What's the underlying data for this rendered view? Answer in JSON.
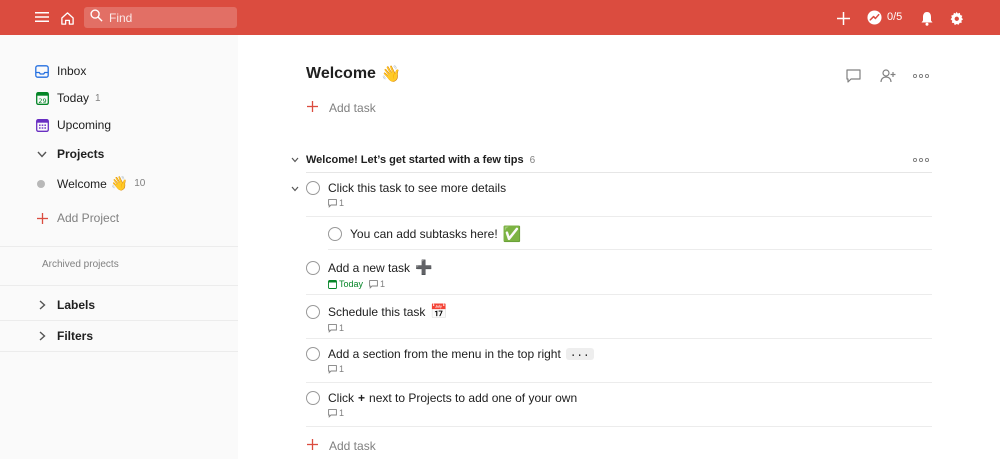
{
  "topbar": {
    "search_placeholder": "Find",
    "karma": "0/5",
    "accent": "#db4c3f"
  },
  "sidebar": {
    "inbox": "Inbox",
    "today": "Today",
    "today_count": "1",
    "upcoming": "Upcoming",
    "projects_heading": "Projects",
    "project_name": "Welcome",
    "project_emoji": "👋",
    "project_count": "10",
    "add_project": "Add Project",
    "archived": "Archived projects",
    "labels": "Labels",
    "filters": "Filters"
  },
  "main": {
    "title": "Welcome",
    "title_emoji": "👋",
    "add_task": "Add task",
    "section": {
      "title": "Welcome! Let’s get started with a few tips",
      "count": "6"
    },
    "tasks": [
      {
        "text": "Click this task to see more details",
        "comments": "1"
      },
      {
        "text": "You can add subtasks here!",
        "emoji": "✅"
      },
      {
        "text": "Add a new task",
        "emoji": "➕",
        "due": "Today",
        "comments": "1"
      },
      {
        "text": "Schedule this task",
        "emoji": "📅",
        "comments": "1"
      },
      {
        "text": "Add a section from the menu in the top right",
        "kbd": "...",
        "comments": "1"
      },
      {
        "text_before": "Click",
        "plus": "+",
        "text_after": "next to Projects to add one of your own",
        "comments": "1"
      }
    ]
  }
}
